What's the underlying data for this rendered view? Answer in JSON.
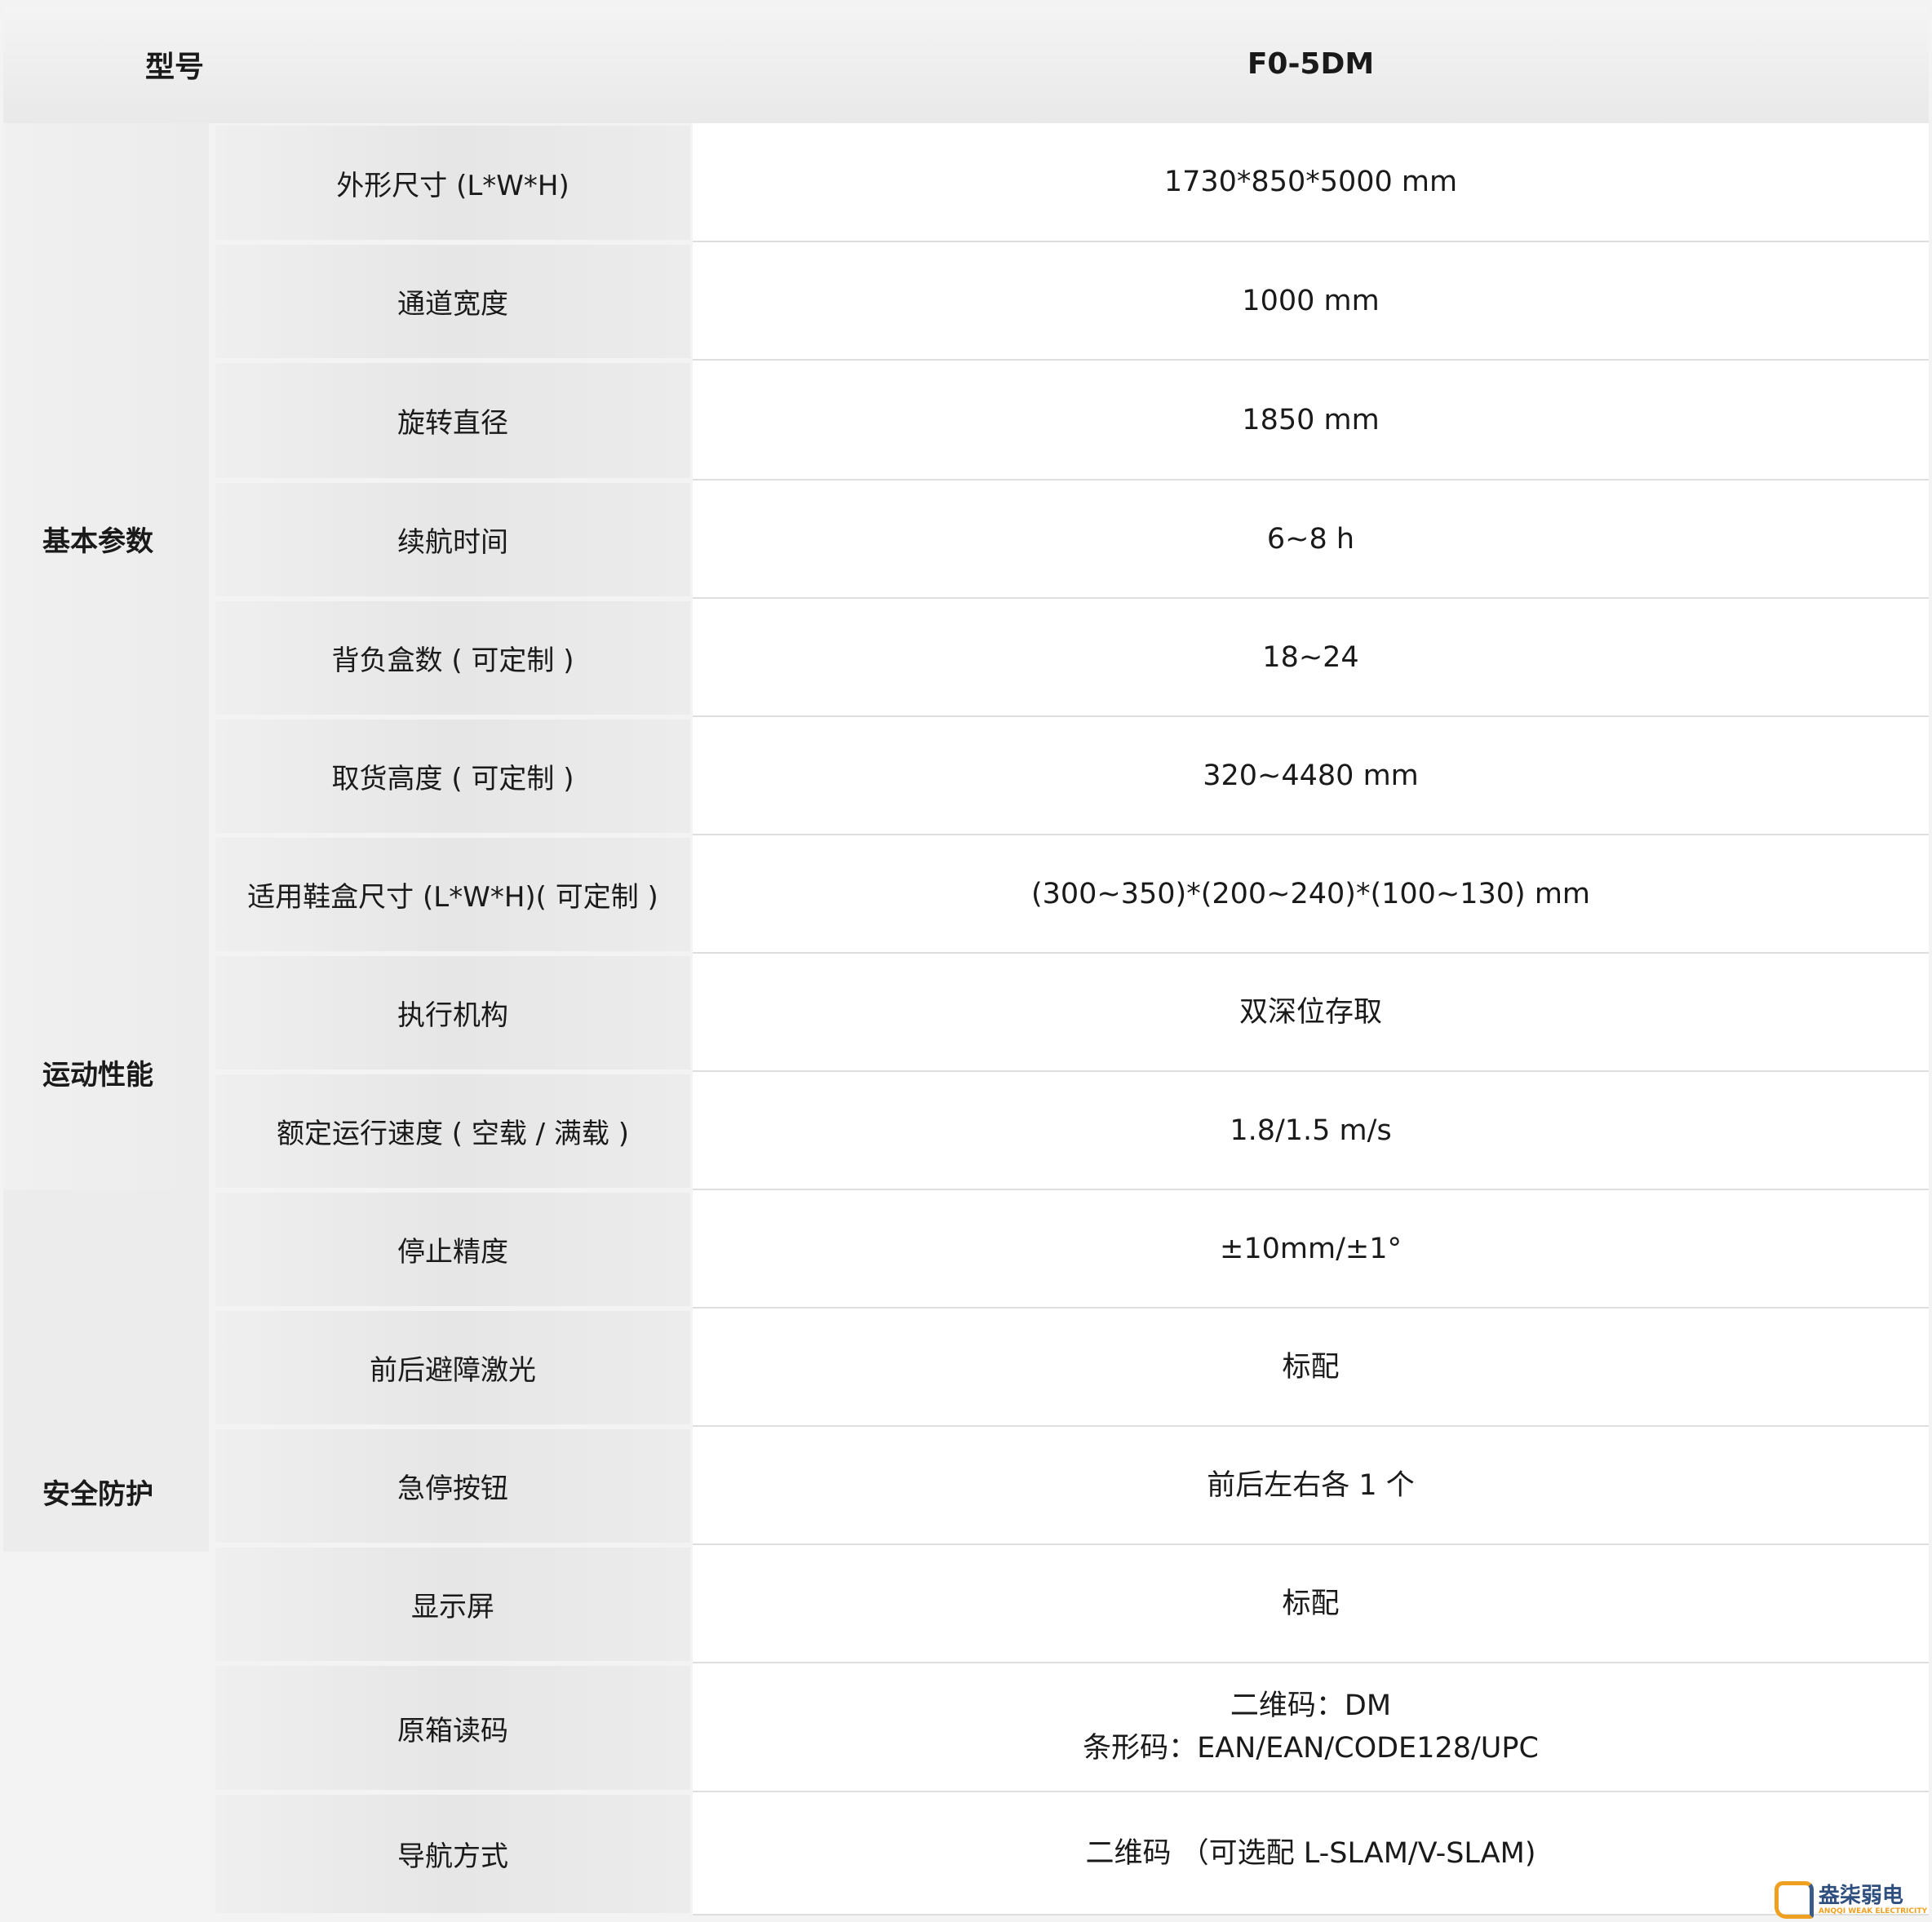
{
  "header": {
    "label": "型号",
    "value": "F0-5DM"
  },
  "categories": [
    {
      "label": "基本参数",
      "rows": 7
    },
    {
      "label": "运动性能",
      "rows": 2
    },
    {
      "label": "安全防护",
      "rows": 5
    }
  ],
  "rows": [
    {
      "label": "外形尺寸 (L*W*H)",
      "value": [
        "1730*850*5000 mm"
      ]
    },
    {
      "label": "通道宽度",
      "value": [
        "1000 mm"
      ]
    },
    {
      "label": "旋转直径",
      "value": [
        "1850 mm"
      ]
    },
    {
      "label": "续航时间",
      "value": [
        "6~8 h"
      ]
    },
    {
      "label": "背负盒数 ( 可定制 )",
      "value": [
        "18~24"
      ]
    },
    {
      "label": "取货高度 ( 可定制 )",
      "value": [
        "320~4480 mm"
      ]
    },
    {
      "label": "适用鞋盒尺寸 (L*W*H)( 可定制 )",
      "value": [
        "(300~350)*(200~240)*(100~130) mm"
      ]
    },
    {
      "label": "执行机构",
      "value": [
        "双深位存取"
      ]
    },
    {
      "label": "额定运行速度 ( 空载 / 满载 )",
      "value": [
        "1.8/1.5 m/s"
      ]
    },
    {
      "label": "停止精度",
      "value": [
        "±10mm/±1°"
      ]
    },
    {
      "label": "前后避障激光",
      "value": [
        "标配"
      ]
    },
    {
      "label": "急停按钮",
      "value": [
        "前后左右各 1 个"
      ]
    },
    {
      "label": "显示屏",
      "value": [
        "标配"
      ]
    },
    {
      "label": "原箱读码",
      "value": [
        "二维码：DM",
        "条形码：EAN/EAN/CODE128/UPC"
      ]
    },
    {
      "label": "导航方式",
      "value": [
        "二维码 （可选配 L-SLAM/V-SLAM)"
      ]
    }
  ],
  "watermark": {
    "name": "盎柒弱电",
    "subtitle": "ANQQI WEAK ELECTRICITY"
  },
  "colors": {
    "header_bg": "#ececec",
    "label_bg": "#e9e9e9",
    "value_bg": "#ffffff",
    "watermark_orange": "#f0a020",
    "watermark_blue": "#2f4f7f"
  }
}
